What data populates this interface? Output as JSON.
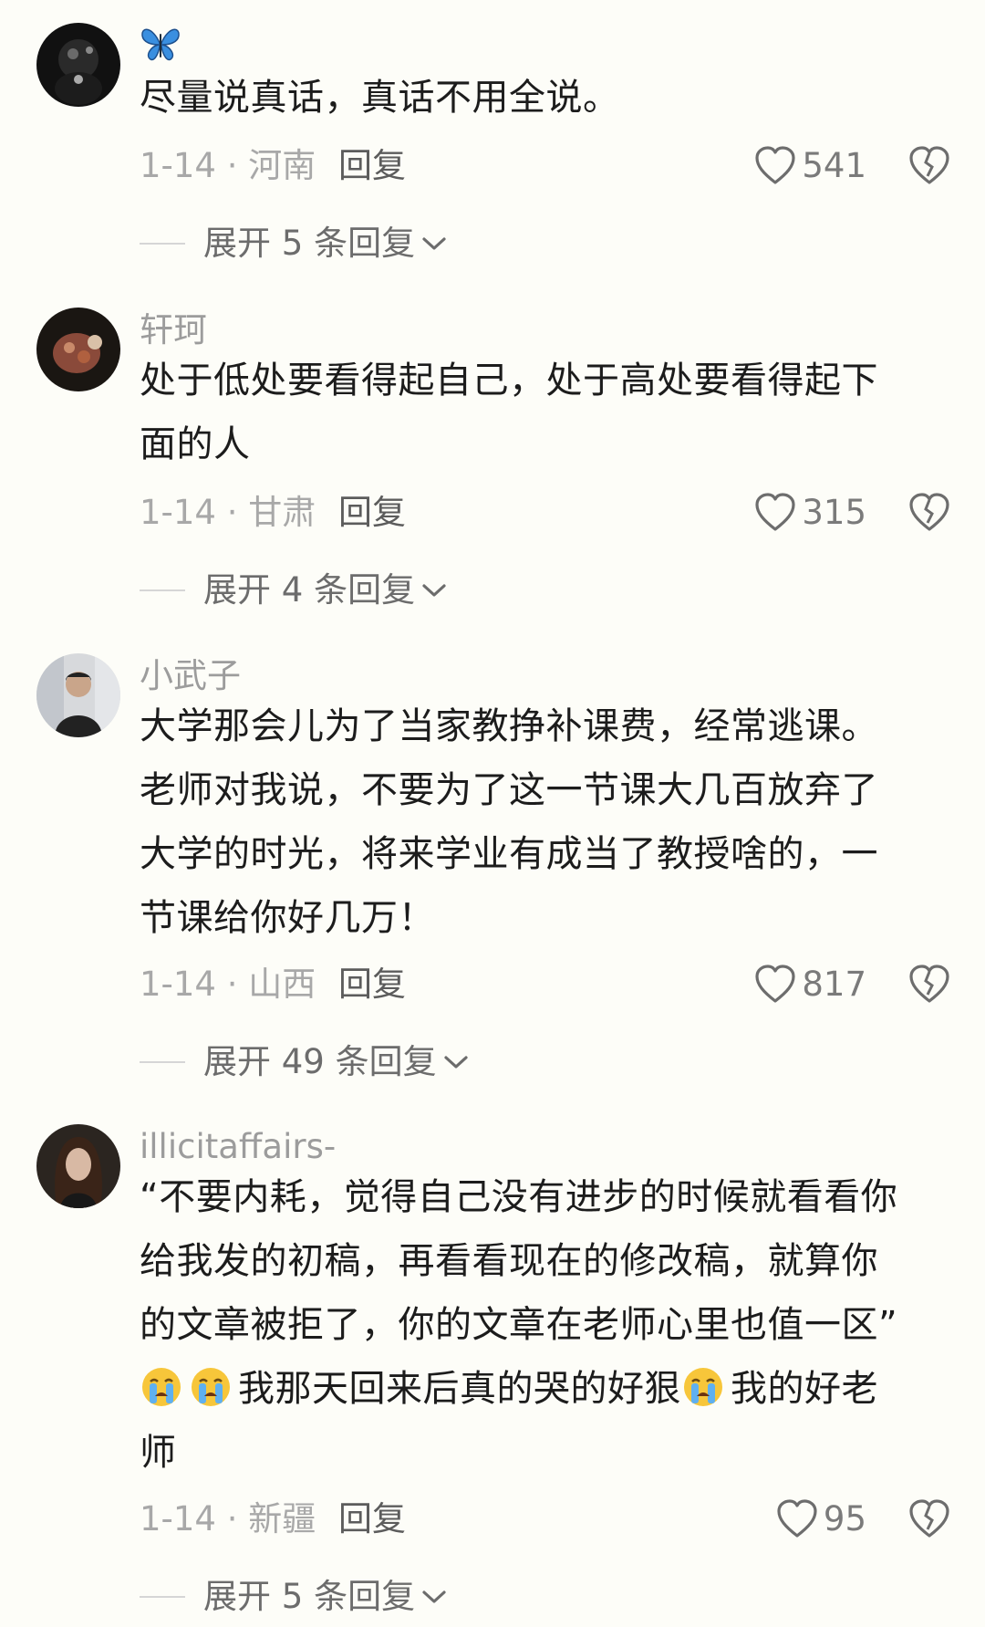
{
  "comments": [
    {
      "username": "",
      "text_lines": [
        "尽量说真话，真话不用全说。"
      ],
      "date_location": "1-14 · 河南",
      "reply_label": "回复",
      "likes": "541",
      "expand_label": "展开 5 条回复"
    },
    {
      "username": "轩珂",
      "text_lines": [
        "处于低处要看得起自己，处于高处要看得起下",
        "面的人"
      ],
      "date_location": "1-14 · 甘肃",
      "reply_label": "回复",
      "likes": "315",
      "expand_label": "展开 4 条回复"
    },
    {
      "username": "小武子",
      "text_lines": [
        "大学那会儿为了当家教挣补课费，经常逃课。",
        "老师对我说，不要为了这一节课大几百放弃了",
        "大学的时光，将来学业有成当了教授啥的，一",
        "节课给你好几万！"
      ],
      "date_location": "1-14 · 山西",
      "reply_label": "回复",
      "likes": "817",
      "expand_label": "展开 49 条回复"
    },
    {
      "username": "illicitaffairs-",
      "text_lines": [
        "“不要内耗，觉得自己没有进步的时候就看看你",
        "给我发的初稿，再看看现在的修改稿，就算你",
        "的文章被拒了，你的文章在老师心里也值一区”"
      ],
      "emoji_line": {
        "part1": "我那天回来后真的哭的好狠",
        "part2": "我的好老"
      },
      "last_line": "师",
      "date_location": "1-14 · 新疆",
      "reply_label": "回复",
      "likes": "95",
      "expand_label": "展开 5 条回复"
    }
  ],
  "icons": {
    "like": "heart-outline-icon",
    "dislike": "broken-heart-icon",
    "expand": "chevron-down-icon",
    "username_emoji": "blue-butterfly-icon",
    "crying_emoji": "loudly-crying-face-icon"
  },
  "colors": {
    "background": "#fdfdf8",
    "text": "#1c1c1c",
    "muted": "#a8a8a8",
    "butterfly": "#3a8fe0",
    "emoji": "#f7c63a"
  }
}
